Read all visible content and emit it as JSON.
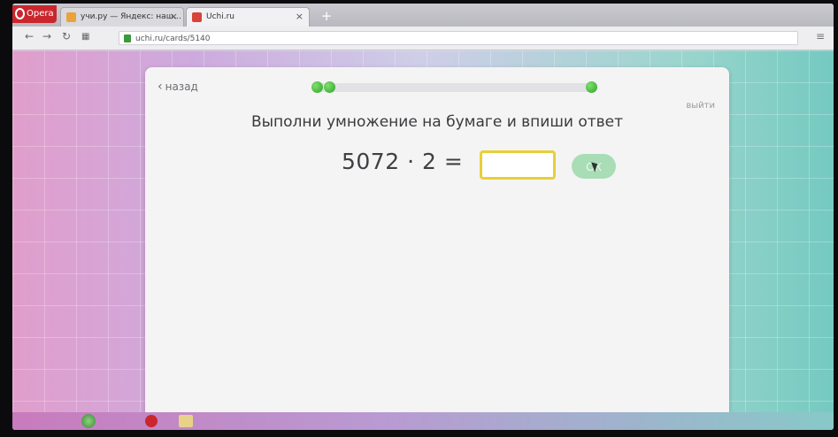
{
  "browser": {
    "menu_label": "Opera",
    "tabs": [
      {
        "label": "учи.ру — Яндекс: наш…",
        "active": false
      },
      {
        "label": "Uchi.ru",
        "active": true
      }
    ],
    "new_tab_label": "+",
    "url": "uchi.ru/cards/5140"
  },
  "task": {
    "back_label": "назад",
    "exit_label": "выйти",
    "progress": {
      "completed_steps": 2
    },
    "instruction": "Выполни умножение на бумаге и впиши ответ",
    "equation": "5072 · 2 =",
    "answer_value": "",
    "ok_label": "ОК"
  },
  "colors": {
    "input_border": "#e8cf3a",
    "ok_button": "#a9ddb6",
    "progress_dot": "#3fb438",
    "opera_red": "#c9272d"
  }
}
